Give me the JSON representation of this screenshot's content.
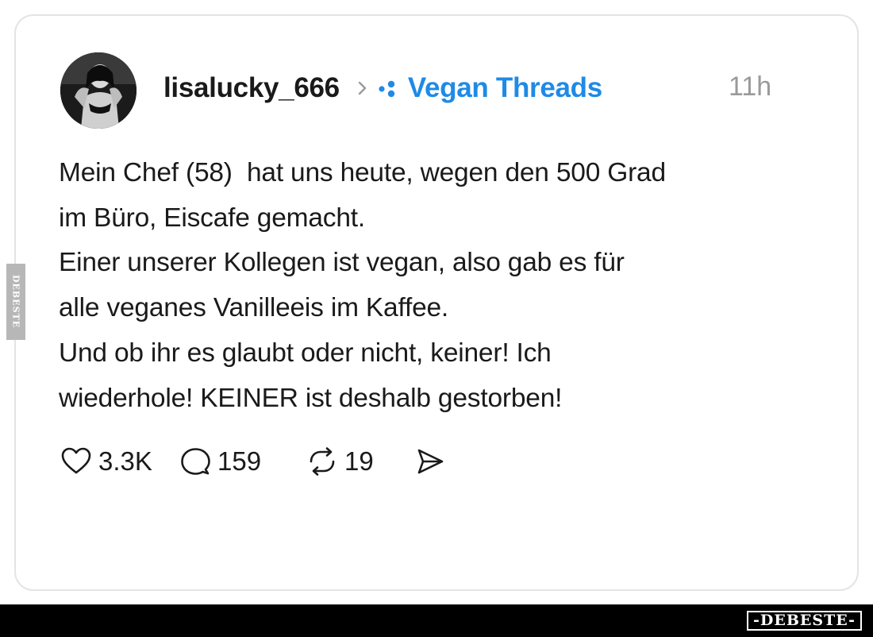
{
  "post": {
    "username": "lisalucky_666",
    "topic": "Vegan Threads",
    "time": "11h",
    "lines": [
      "Mein Chef (58)  hat uns heute, wegen den 500 Grad",
      "im Büro, Eiscafe gemacht.",
      "Einer unserer Kollegen ist vegan, also gab es für",
      "alle veganes Vanilleeis im Kaffee.",
      "Und ob ihr es glaubt oder nicht, keiner! Ich",
      "wiederhole! KEINER ist deshalb gestorben!"
    ]
  },
  "actions": {
    "likes": "3.3K",
    "comments": "159",
    "reposts": "19"
  },
  "icons": [
    "avatar",
    "chevron-right-icon",
    "topic-dots-icon",
    "heart-icon",
    "comment-icon",
    "repost-icon",
    "share-icon"
  ],
  "colors": {
    "topic": "#1f8ae6",
    "timestamp": "#9a9a9a",
    "card_border": "#e4e4e4",
    "footer": "#000000"
  },
  "watermark": {
    "side": "DEBESTE",
    "footer": "-DEBESTE-"
  }
}
